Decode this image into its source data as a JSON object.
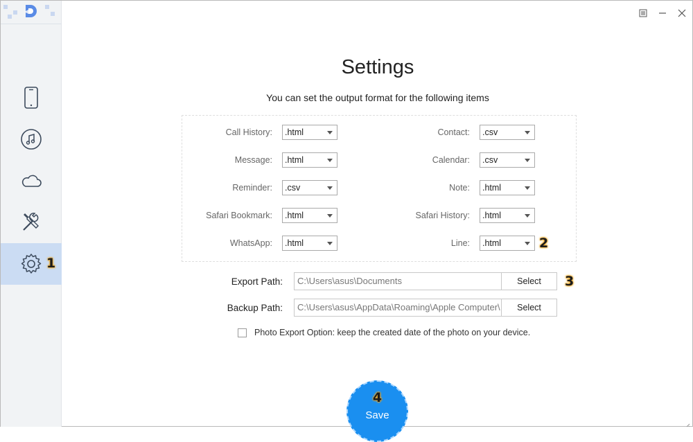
{
  "window": {
    "menu_icon": "list-icon",
    "minimize_icon": "minimize-icon",
    "close_icon": "close-icon"
  },
  "sidebar": {
    "logo": "app-logo",
    "items": [
      {
        "name": "device",
        "icon": "phone-icon"
      },
      {
        "name": "itunes",
        "icon": "music-icon"
      },
      {
        "name": "icloud",
        "icon": "cloud-icon"
      },
      {
        "name": "tools",
        "icon": "tools-icon"
      },
      {
        "name": "settings",
        "icon": "gear-icon",
        "active": true
      }
    ],
    "annotation": "1"
  },
  "settings": {
    "title": "Settings",
    "subtitle": "You can set the output format for the following items",
    "left_formats": [
      {
        "label": "Call History:",
        "value": ".html"
      },
      {
        "label": "Message:",
        "value": ".html"
      },
      {
        "label": "Reminder:",
        "value": ".csv"
      },
      {
        "label": "Safari Bookmark:",
        "value": ".html"
      },
      {
        "label": "WhatsApp:",
        "value": ".html"
      }
    ],
    "right_formats": [
      {
        "label": "Contact:",
        "value": ".csv"
      },
      {
        "label": "Calendar:",
        "value": ".csv"
      },
      {
        "label": "Note:",
        "value": ".html"
      },
      {
        "label": "Safari History:",
        "value": ".html"
      },
      {
        "label": "Line:",
        "value": ".html"
      }
    ],
    "annotation_formats": "2",
    "export_path": {
      "label": "Export Path:",
      "value": "C:\\Users\\asus\\Documents",
      "button": "Select"
    },
    "annotation_export": "3",
    "backup_path": {
      "label": "Backup Path:",
      "value": "C:\\Users\\asus\\AppData\\Roaming\\Apple Computer\\",
      "button": "Select"
    },
    "photo_option": {
      "label": "Photo Export Option: keep the created date of the photo on your device.",
      "checked": false
    },
    "save": {
      "label": "Save",
      "annotation": "4"
    }
  },
  "colors": {
    "accent": "#1a8ff0",
    "sidebar_bg": "#f1f3f5",
    "active_bg": "#cbdcf3",
    "icon_color": "#3c4a5c",
    "annotation_glow": "#f3a81c"
  }
}
